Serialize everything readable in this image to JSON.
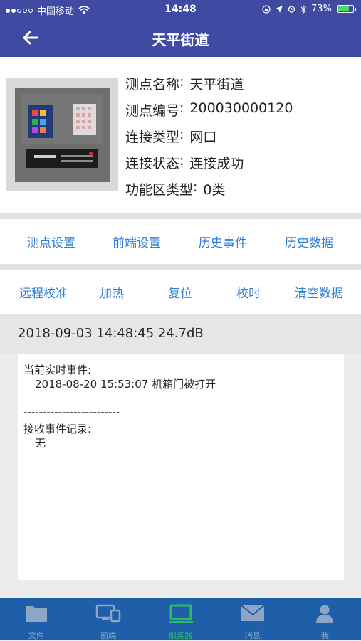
{
  "status_bar": {
    "carrier": "中国移动",
    "time": "14:48",
    "battery": "73%",
    "battery_level": 0.73
  },
  "header": {
    "title": "天平街道"
  },
  "device": {
    "fields": [
      {
        "label": "测点名称",
        "value": "天平街道"
      },
      {
        "label": "测点编号",
        "value": "200030000120"
      },
      {
        "label": "连接类型",
        "value": "网口"
      },
      {
        "label": "连接状态",
        "value": "连接成功"
      },
      {
        "label": "功能区类型",
        "value": "0类"
      }
    ],
    "separator": ":"
  },
  "actions_primary": [
    "测点设置",
    "前端设置",
    "历史事件",
    "历史数据"
  ],
  "actions_secondary": [
    "远程校准",
    "加热",
    "复位",
    "校时",
    "清空数据"
  ],
  "reading": {
    "text": "2018-09-03 14:48:45 24.7dB"
  },
  "events": {
    "current_title": "当前实时事件:",
    "current_item": "2018-08-20 15:53:07 机箱门被打开",
    "divider": "-------------------------",
    "history_title": "接收事件记录:",
    "history_item": "无"
  },
  "tabs": [
    {
      "label": "文件",
      "icon": "folder-icon"
    },
    {
      "label": "前端",
      "icon": "devices-icon"
    },
    {
      "label": "服务器",
      "icon": "monitor-icon",
      "active": true
    },
    {
      "label": "消息",
      "icon": "mail-icon"
    },
    {
      "label": "我",
      "icon": "person-icon"
    }
  ],
  "colors": {
    "header": "#3f4aa3",
    "tabbar": "#1f5fa9",
    "link": "#2f7fd6",
    "active_tab": "#28c05a"
  }
}
